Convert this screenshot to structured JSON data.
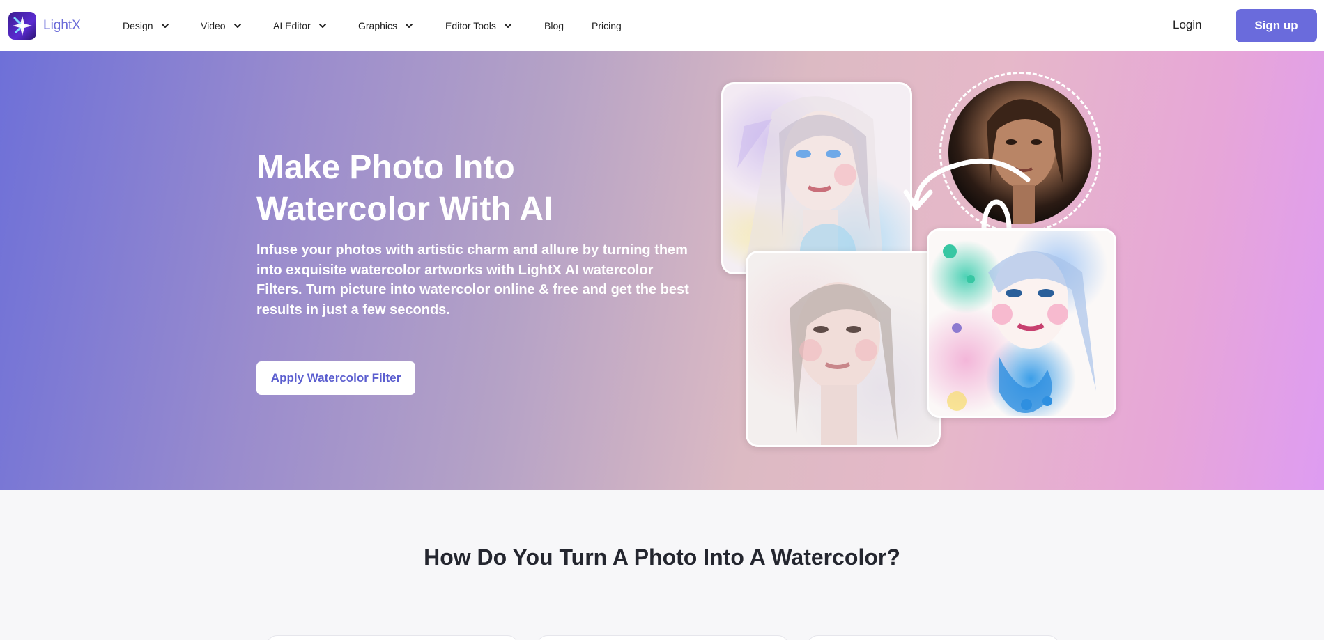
{
  "brand": {
    "name": "LightX",
    "logo_icon": "lightx-logo-icon"
  },
  "nav": {
    "items": [
      {
        "label": "Design",
        "has_dropdown": true
      },
      {
        "label": "Video",
        "has_dropdown": true
      },
      {
        "label": "AI Editor",
        "has_dropdown": true
      },
      {
        "label": "Graphics",
        "has_dropdown": true
      },
      {
        "label": "Editor Tools",
        "has_dropdown": true
      },
      {
        "label": "Blog",
        "has_dropdown": false
      },
      {
        "label": "Pricing",
        "has_dropdown": false
      }
    ],
    "login_label": "Login",
    "signup_label": "Sign up"
  },
  "hero": {
    "title": "Make Photo Into Watercolor With AI",
    "description": "Infuse your photos with artistic charm and allure by turning them into exquisite watercolor artworks with LightX AI watercolor Filters. Turn picture into watercolor online & free and get the best results in just a few seconds.",
    "cta_label": "Apply Watercolor Filter"
  },
  "section2": {
    "title": "How Do You Turn A Photo Into A Watercolor?"
  },
  "colors": {
    "accent": "#6a6bdc",
    "brand_text": "#6a6bd8",
    "hero_gradient_start": "#6e70d8",
    "hero_gradient_end": "#de9cf2"
  }
}
